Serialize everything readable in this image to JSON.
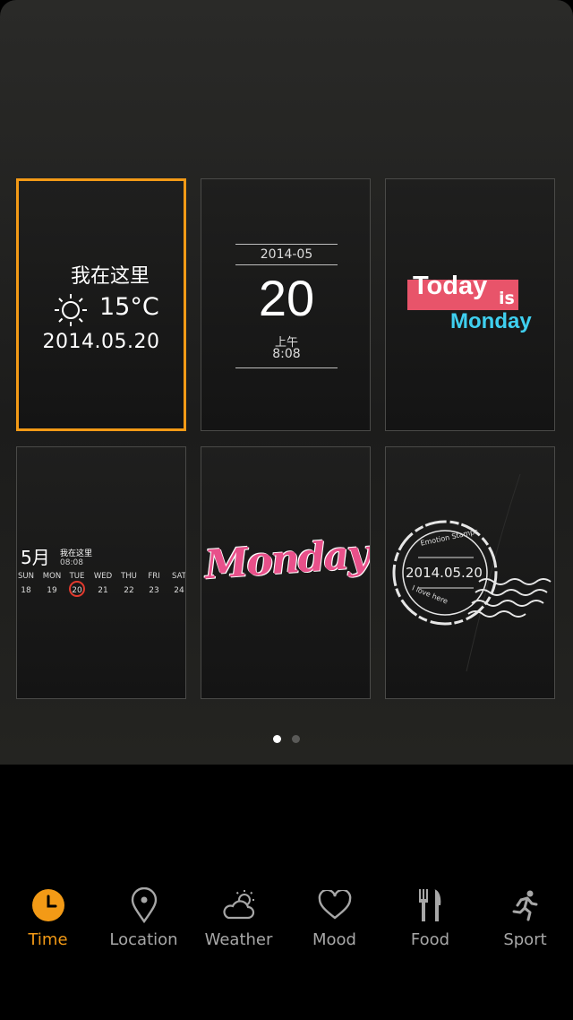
{
  "widgets": {
    "weather_time": {
      "location": "我在这里",
      "temperature": "15°C",
      "date": "2014.05.20"
    },
    "calendar_clock": {
      "year_month": "2014-05",
      "day": "20",
      "am_pm": "上午",
      "time": "8:08"
    },
    "today_is": {
      "today": "Today",
      "is": "is",
      "weekday": "Monday"
    },
    "month_calendar": {
      "month": "5月",
      "location": "我在这里",
      "time": "08:08",
      "weekdays": [
        "SUN",
        "MON",
        "TUE",
        "WED",
        "THU",
        "FRI",
        "SAT"
      ],
      "dates": [
        "18",
        "19",
        "20",
        "21",
        "22",
        "23",
        "24"
      ],
      "highlighted": "20"
    },
    "script_day": {
      "text": "Monday"
    },
    "stamp": {
      "date": "2014.05.20",
      "top_text": "Emotion Stamps",
      "bottom_text": "I love here"
    }
  },
  "pager": {
    "pages": 2,
    "current": 1
  },
  "tabs": [
    {
      "label": "Time",
      "icon": "clock-icon",
      "active": true
    },
    {
      "label": "Location",
      "icon": "location-pin-icon",
      "active": false
    },
    {
      "label": "Weather",
      "icon": "weather-icon",
      "active": false
    },
    {
      "label": "Mood",
      "icon": "heart-icon",
      "active": false
    },
    {
      "label": "Food",
      "icon": "fork-knife-icon",
      "active": false
    },
    {
      "label": "Sport",
      "icon": "running-icon",
      "active": false
    }
  ],
  "colors": {
    "accent": "#f39a16",
    "inactive": "#a7a7a7",
    "today_bg": "#e8546a",
    "monday_blue": "#3fd0f0",
    "script_pink": "#e8508a",
    "calendar_ring": "#e23a2e"
  }
}
